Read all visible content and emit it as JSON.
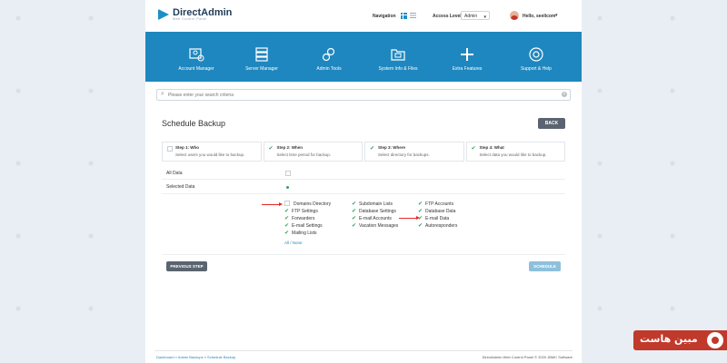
{
  "app": {
    "logo_text": "DirectAdmin",
    "logo_sub": "Web Control Panel"
  },
  "topbar": {
    "navigation_label": "Navigation",
    "access_level_label": "Access Level",
    "access_level_value": "Admin",
    "user_greeting": "Hello, seelicom"
  },
  "menu": [
    {
      "label": "Account Manager",
      "icon": "account-manager-icon"
    },
    {
      "label": "Server Manager",
      "icon": "server-manager-icon"
    },
    {
      "label": "Admin Tools",
      "icon": "admin-tools-icon"
    },
    {
      "label": "System Info & Files",
      "icon": "system-info-icon"
    },
    {
      "label": "Extra Features",
      "icon": "plus-icon"
    },
    {
      "label": "Support & Help",
      "icon": "lifebuoy-icon"
    }
  ],
  "search": {
    "placeholder": "Please enter your search criteria"
  },
  "page": {
    "title": "Schedule Backup",
    "back_label": "BACK"
  },
  "steps": [
    {
      "title": "Step 1: Who",
      "desc": "Select users you would like to backup.",
      "done": false
    },
    {
      "title": "Step 2: When",
      "desc": "Select time period for backup.",
      "done": true
    },
    {
      "title": "Step 3: Where",
      "desc": "Select directory for backups.",
      "done": true
    },
    {
      "title": "Step 4: What",
      "desc": "Select data you would like to backup.",
      "done": true
    }
  ],
  "options": {
    "all_data_label": "All Data",
    "selected_data_label": "Selected Data"
  },
  "items": {
    "col1": [
      {
        "label": "Domains Directory",
        "checked": false
      },
      {
        "label": "FTP Settings",
        "checked": true
      },
      {
        "label": "Forwarders",
        "checked": true
      },
      {
        "label": "E-mail Settings",
        "checked": true
      },
      {
        "label": "Mailing Lists",
        "checked": true
      }
    ],
    "col2": [
      {
        "label": "Subdomain Lists",
        "checked": true
      },
      {
        "label": "Database Settings",
        "checked": true
      },
      {
        "label": "E-mail Accounts",
        "checked": true
      },
      {
        "label": "Vacation Messages",
        "checked": true
      }
    ],
    "col3": [
      {
        "label": "FTP Accounts",
        "checked": true
      },
      {
        "label": "Database Data",
        "checked": true
      },
      {
        "label": "E-mail Data",
        "checked": true
      },
      {
        "label": "Autoresponders",
        "checked": true
      }
    ],
    "all_none_label": "All / None"
  },
  "buttons": {
    "previous_label": "PREVIOUS STEP",
    "schedule_label": "SCHEDULE"
  },
  "footer": {
    "breadcrumb": "Dashboard » Admin Backups » Schedule Backup",
    "copyright": "DirectAdmin Web Control Panel © 2020 JBMC Software"
  },
  "watermark": {
    "text": "مبین هاست"
  },
  "colors": {
    "brand_blue": "#1f87bf",
    "check_green": "#2aa55a",
    "arrow_red": "#e52727"
  }
}
